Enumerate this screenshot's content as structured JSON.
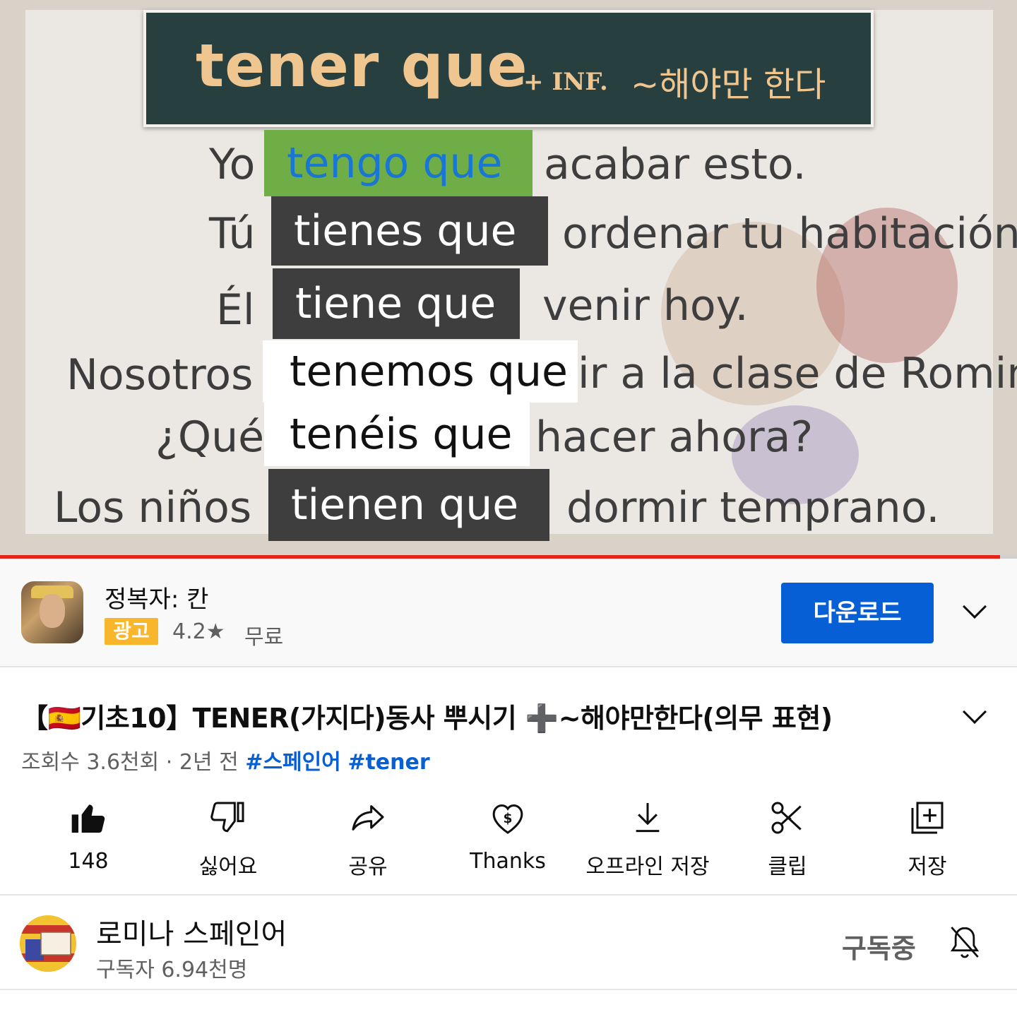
{
  "video": {
    "title_main": "tener que",
    "title_inf": "+ INF.",
    "title_korean": "~해야만 한다",
    "rows": [
      {
        "subject": "Yo",
        "verb": "tengo que",
        "rest": "acabar esto."
      },
      {
        "subject": "Tú",
        "verb": "tienes que",
        "rest": "ordenar tu habitación."
      },
      {
        "subject": "Él",
        "verb": "tiene que",
        "rest": "venir hoy."
      },
      {
        "subject": "Nosotros",
        "verb": "tenemos que",
        "rest": "ir a la clase de Romina."
      },
      {
        "subject": "¿Qué",
        "verb": "tenéis que",
        "rest": "hacer ahora?"
      },
      {
        "subject": "Los niños",
        "verb": "tienen que",
        "rest": "dormir temprano."
      }
    ],
    "progress_fraction": 0.983
  },
  "ad": {
    "title": "정복자: 칸",
    "badge": "광고",
    "rating": "4.2★",
    "price": "무료",
    "button": "다운로드",
    "expand_icon": "chevron-down-icon"
  },
  "video_info": {
    "title": "【🇪🇸기초10】TENER(가지다)동사 뿌시기 ➕~해야만한다(의무 표현)",
    "views": "조회수 3.6천회 · 2년 전",
    "tags": [
      "#스페인어",
      "#tener"
    ]
  },
  "actions": [
    {
      "icon": "thumbs-up-filled-icon",
      "label": "148"
    },
    {
      "icon": "thumbs-down-icon",
      "label": "싫어요"
    },
    {
      "icon": "share-icon",
      "label": "공유"
    },
    {
      "icon": "thanks-heart-dollar-icon",
      "label": "Thanks"
    },
    {
      "icon": "download-icon",
      "label": "오프라인 저장"
    },
    {
      "icon": "scissors-icon",
      "label": "클립"
    },
    {
      "icon": "playlist-add-icon",
      "label": "저장"
    }
  ],
  "channel": {
    "name": "로미나 스페인어",
    "subscribers": "구독자 6.94천명",
    "subscribe_state": "구독중",
    "bell_icon": "bell-off-icon"
  },
  "colors": {
    "accent_blue": "#065fd4",
    "progress_red": "#e62117",
    "ad_badge": "#f7b62b",
    "slide_title_bg": "#283f40",
    "slide_title_text": "#f0c690",
    "highlight_green": "#6fae47"
  }
}
